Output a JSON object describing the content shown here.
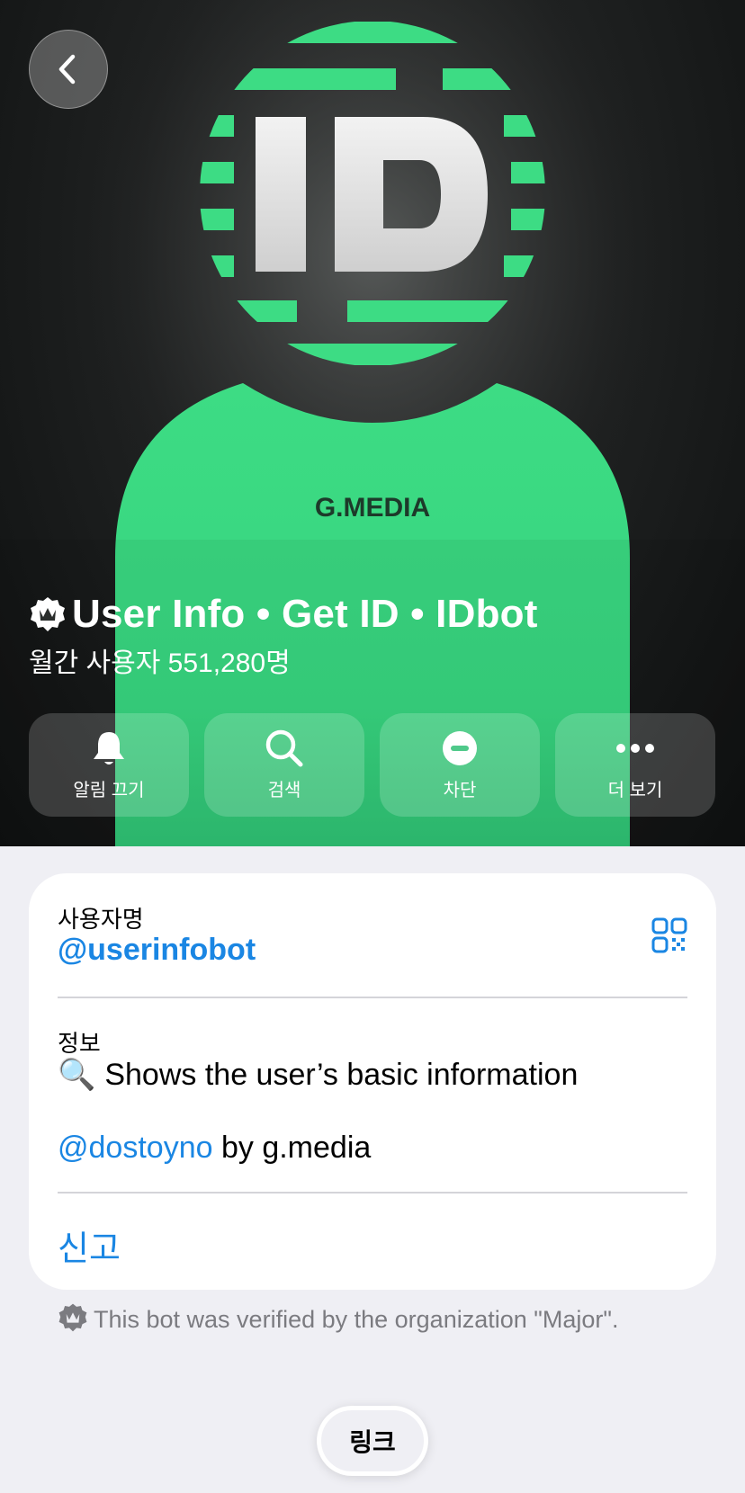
{
  "hero": {
    "brand_text": "G.MEDIA",
    "logo_text": "ID",
    "title": "User Info • Get ID • IDbot",
    "subtitle": "월간 사용자 551,280명",
    "accent_color": "#3ddc84"
  },
  "actions": [
    {
      "label": "알림 끄기",
      "icon": "bell-icon"
    },
    {
      "label": "검색",
      "icon": "search-icon"
    },
    {
      "label": "차단",
      "icon": "block-icon"
    },
    {
      "label": "더 보기",
      "icon": "more-icon"
    }
  ],
  "info": {
    "username_label": "사용자명",
    "username": "@userinfobot",
    "about_label": "정보",
    "about_emoji": "🔍",
    "about_text": "Shows the user’s basic information",
    "about_mention": "@dostoyno",
    "about_suffix": " by g.media",
    "report_label": "신고",
    "link_color": "#1a86e3"
  },
  "verified_note": "This bot was verified by the organization \"Major\".",
  "link_button": "링크"
}
